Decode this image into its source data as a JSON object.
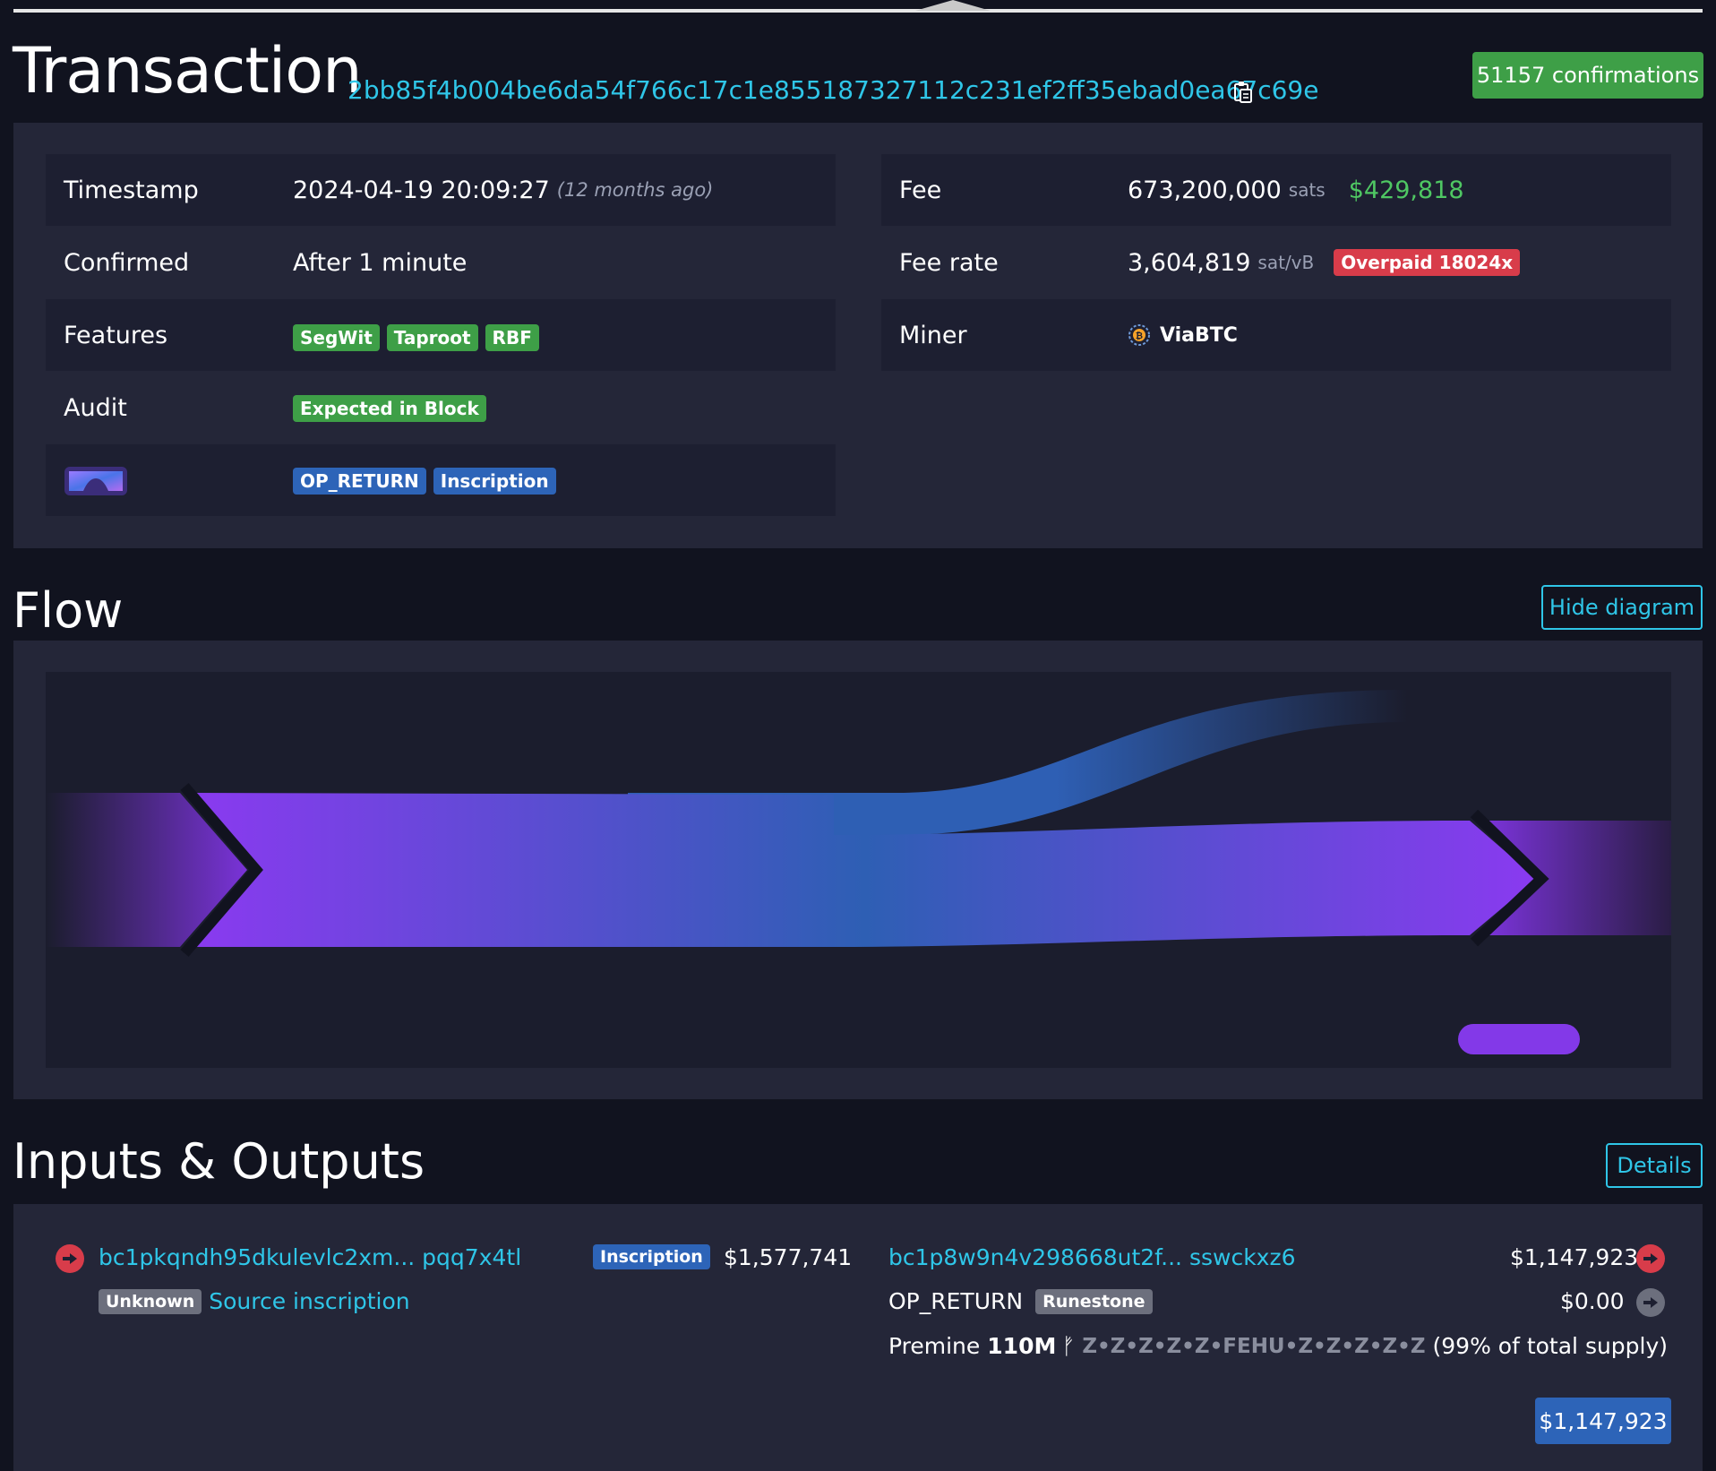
{
  "header": {
    "title": "Transaction",
    "txid": "2bb85f4b004be6da54f766c17c1e855187327112c231ef2ff35ebad0ea67c69e",
    "confirmations": "51157 confirmations"
  },
  "details": {
    "left": {
      "timestamp_label": "Timestamp",
      "timestamp_value": "2024-04-19 20:09:27",
      "timestamp_ago": "(12 months ago)",
      "confirmed_label": "Confirmed",
      "confirmed_value": "After 1 minute",
      "features_label": "Features",
      "features": [
        "SegWit",
        "Taproot",
        "RBF"
      ],
      "audit_label": "Audit",
      "audit_value": "Expected in Block",
      "extra_tags": [
        "OP_RETURN",
        "Inscription"
      ]
    },
    "right": {
      "fee_label": "Fee",
      "fee_value": "673,200,000",
      "fee_unit": "sats",
      "fee_usd": "$429,818",
      "feerate_label": "Fee rate",
      "feerate_value": "3,604,819",
      "feerate_unit": "sat/vB",
      "overpaid": "Overpaid 18024x",
      "miner_label": "Miner",
      "miner_value": "ViaBTC"
    }
  },
  "flow": {
    "title": "Flow",
    "hide_button": "Hide diagram"
  },
  "io": {
    "title": "Inputs & Outputs",
    "details_button": "Details",
    "inputs": [
      {
        "address": "bc1pkqndh95dkulevlc2xm... pqq7x4tl",
        "tag": "Inscription",
        "value": "$1,577,741",
        "sub_tag": "Unknown",
        "sub_link": "Source inscription"
      }
    ],
    "outputs": [
      {
        "address": "bc1p8w9n4v298668ut2f... sswckxz6",
        "value": "$1,147,923"
      },
      {
        "address": "OP_RETURN",
        "tag": "Runestone",
        "value": "$0.00"
      }
    ],
    "runestone": {
      "prefix": "Premine",
      "amount": "110M",
      "symbol": "ᚠ",
      "name": "Z•Z•Z•Z•Z•FEHU•Z•Z•Z•Z•Z",
      "suffix": "(99% of total supply)"
    },
    "total": "$1,147,923"
  },
  "colors": {
    "accent": "#2fc6e8",
    "green": "#3e9f47",
    "red": "#d83c4a",
    "blue": "#2d64b8",
    "purple": "#8339e8"
  }
}
